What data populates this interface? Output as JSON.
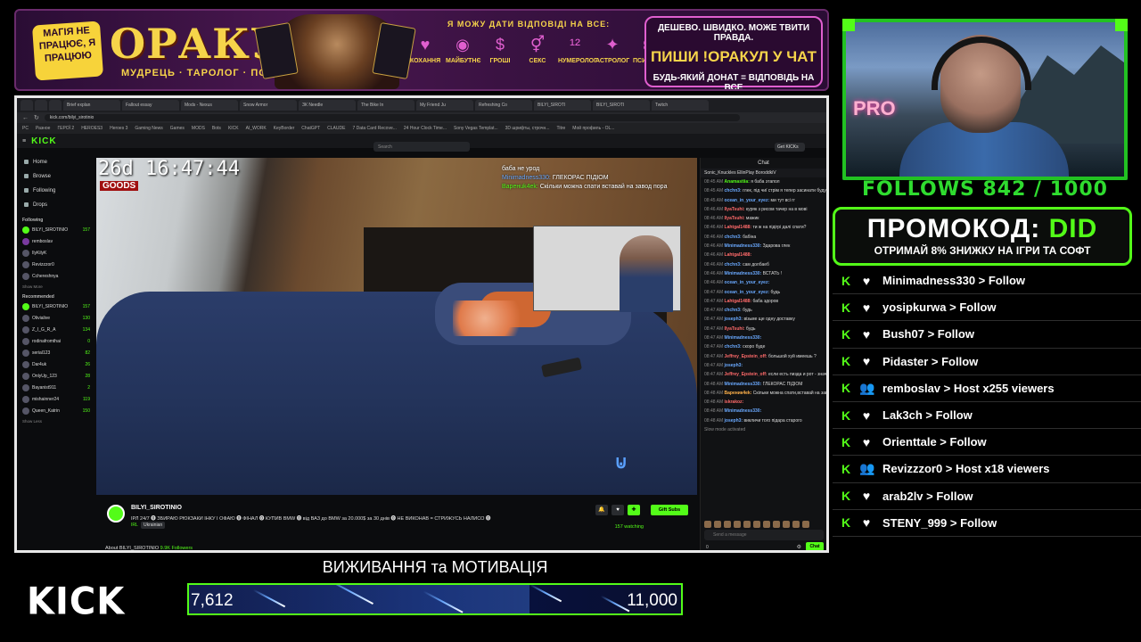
{
  "banner": {
    "badge_text": "МАГІЯ НЕ ПРАЦЮЄ, Я ПРАЦЮЮ",
    "title": "ОРАКУЛ",
    "subtitle": "МУДРЕЦЬ · ТАРОЛОГ · ПСИХОЛОГ",
    "answers_heading": "Я МОЖУ ДАТИ ВІДПОВІДІ НА ВСЕ:",
    "topics": [
      "КОХАННЯ",
      "МАЙБУТНЄ",
      "ГРОШІ",
      "СЕКС",
      "НУМЕРОЛОГ",
      "АСТРОЛОГ",
      "ПСИХОЛОГ"
    ],
    "cta_line1": "ДЕШЕВО. ШВИДКО. МОЖЕ ТВИТИ ПРАВДА.",
    "cta_line2": "ПИШИ !ОРАКУЛ У ЧАТ",
    "cta_line3": "БУДЬ-ЯКИЙ ДОНАТ = ВІДПОВІДЬ НА ВСЕ"
  },
  "browser": {
    "tabs": [
      "Brief explan",
      "Fallout essay",
      "Mods - Nexus",
      "Snow Armor",
      "ЗК Needle",
      "The Bike In",
      "My Friend Ju",
      "Refreshing Co",
      "BILYI_SIROTI",
      "BILYI_SIROTI",
      "Twitch"
    ],
    "url": "kick.com/bilyi_sirotinio",
    "bookmarks": [
      "PC",
      "Разное",
      "ГЕРОЇ 2",
      "HEROES3",
      "Heroes 3",
      "Gaming News",
      "Games",
      "MODS",
      "Bots",
      "KICK",
      "AI_WORK",
      "KeyBorder",
      "ChatGPT",
      "CLAUDE",
      "7 Data Card Recove...",
      "24 Hour Clock Time...",
      "Sony Vegas Templat...",
      "3D шрифты, строчн...",
      "Titre",
      "Мой профиль - OL..."
    ]
  },
  "kick_page": {
    "search_placeholder": "Search",
    "get_kick": "Get KICKs",
    "nav": [
      "Home",
      "Browse",
      "Following",
      "Drops"
    ],
    "following_header": "Following",
    "following": [
      {
        "name": "BILYI_SIROTINIO",
        "viewers": "157"
      },
      {
        "name": "remboslav",
        "viewers": ""
      },
      {
        "name": "IlyKilyK",
        "viewers": ""
      },
      {
        "name": "Revizzzor0",
        "viewers": ""
      },
      {
        "name": "Cchereshnya",
        "viewers": ""
      }
    ],
    "show_more": "Show More",
    "recommended_header": "Recommended",
    "recommended": [
      {
        "name": "BILYI_SIROTINIO",
        "viewers": "157"
      },
      {
        "name": "Olivialive",
        "viewers": "130"
      },
      {
        "name": "Z_I_G_R_A",
        "viewers": "134"
      },
      {
        "name": "rodinafromthai",
        "viewers": "0"
      },
      {
        "name": "serial123",
        "viewers": "82"
      },
      {
        "name": "Dar4uk",
        "viewers": "26"
      },
      {
        "name": "OnlyUp_123",
        "viewers": "28"
      },
      {
        "name": "Bayanist911",
        "viewers": "2"
      },
      {
        "name": "mishainner24",
        "viewers": "119"
      },
      {
        "name": "Queen_Katrin",
        "viewers": "150"
      }
    ],
    "show_less": "Show Less",
    "video_timestamp": "26d 16:47:44",
    "video_tag": "GOODS",
    "overlay_chat": [
      {
        "user": "",
        "text": "баба не урод"
      },
      {
        "user": "Minimadness330:",
        "text": "ГЛЕКОРАС ПІДІОМ"
      },
      {
        "user": "Варенuk4ek:",
        "text": "Скільки можна спати вставай на завод пора"
      }
    ],
    "channel_name": "BILYI_SIROTINIO",
    "stream_title": "ІРЛ 24/7 ⓿ ЗБИРАЮ РЮКЗАКИ ІНКУ І ОФАЮ ⓿ ФІНАЛ ⓿ КУПИВ BMW ⓿ від ВАЗ до BMW за 20.000$ за 30 днів ⓿ НЕ ВИКОНАВ = СТРИЖУСЬ НАЛИСО ⓿",
    "category": "IRL",
    "language": "Ukrainian",
    "gift_subs": "Gift Subs",
    "watching": "157 watching",
    "about": "About BILYI_SIROTINIO",
    "followers": "9.9K Followers",
    "chat_header": "Chat",
    "pinned": "Sonic_Knuckles  EllinPlay  BoroddkiV",
    "chat_messages": [
      {
        "t": "08:45 AM",
        "u": "Anamastiia:",
        "c": "g",
        "m": "я баба этапол"
      },
      {
        "t": "08:45 AM",
        "u": "chchn3:",
        "c": "",
        "m": "глек, під чиї стрім я тепер засинати буду?"
      },
      {
        "t": "08:45 AM",
        "u": "ocean_in_your_eyez:",
        "c": "",
        "m": "ми тут всі гг"
      },
      {
        "t": "08:46 AM",
        "u": "IlyaTsuhi:",
        "c": "r",
        "m": "куряк з рисом тачер на в мові"
      },
      {
        "t": "08:46 AM",
        "u": "IlyaTsuhi:",
        "c": "r",
        "m": "мажик"
      },
      {
        "t": "08:46 AM",
        "u": "Lahtgal1488:",
        "c": "r",
        "m": "ти ж на підігрі далі спати?"
      },
      {
        "t": "08:46 AM",
        "u": "chchn3:",
        "c": "",
        "m": "бабіна"
      },
      {
        "t": "08:46 AM",
        "u": "Minimadness330:",
        "c": "",
        "m": "Здарова глек"
      },
      {
        "t": "08:46 AM",
        "u": "Lahtgal1488:",
        "c": "r",
        "m": ""
      },
      {
        "t": "08:46 AM",
        "u": "chchn3:",
        "c": "",
        "m": "сам долбаеб"
      },
      {
        "t": "08:46 AM",
        "u": "Minimadness330:",
        "c": "",
        "m": "ВСТАТЬ !"
      },
      {
        "t": "08:46 AM",
        "u": "ocean_in_your_eyez:",
        "c": "",
        "m": ""
      },
      {
        "t": "08:47 AM",
        "u": "ocean_in_your_eyez:",
        "c": "",
        "m": "будь"
      },
      {
        "t": "08:47 AM",
        "u": "Lahtgal1488:",
        "c": "r",
        "m": "баба здоров"
      },
      {
        "t": "08:47 AM",
        "u": "chchn3:",
        "c": "",
        "m": "будь"
      },
      {
        "t": "08:47 AM",
        "u": "joseph3:",
        "c": "",
        "m": "візьме ще одну доставку"
      },
      {
        "t": "08:47 AM",
        "u": "IlyaTsuhi:",
        "c": "r",
        "m": "будь"
      },
      {
        "t": "08:47 AM",
        "u": "Minimadness330:",
        "c": "",
        "m": ""
      },
      {
        "t": "08:47 AM",
        "u": "chchn3:",
        "c": "",
        "m": "скоро буде"
      },
      {
        "t": "08:47 AM",
        "u": "Jeffrey_Epstein_off:",
        "c": "r",
        "m": "большой хуй имеешь ?"
      },
      {
        "t": "08:47 AM",
        "u": "joseph3:",
        "c": "",
        "m": ""
      },
      {
        "t": "08:47 AM",
        "u": "Jeffrey_Epstein_off:",
        "c": "r",
        "m": "если есть пизда и рот - значит баба не урод"
      },
      {
        "t": "08:48 AM",
        "u": "Minimadness330:",
        "c": "",
        "m": "ГЛЕКОРАС ПІДІОМ"
      },
      {
        "t": "08:48 AM",
        "u": "Вареник4ek:",
        "c": "o",
        "m": "Скільки можна спати,вставай на завод пора"
      },
      {
        "t": "08:48 AM",
        "u": "iskrakoz:",
        "c": "r",
        "m": ""
      },
      {
        "t": "08:48 AM",
        "u": "Minimadness330:",
        "c": "",
        "m": ""
      },
      {
        "t": "08:48 AM",
        "u": "joseph3:",
        "c": "",
        "m": "викличи того підара старого"
      }
    ],
    "slow_mode": "Slow mode activated",
    "send_placeholder": "Send a message",
    "chat_count": "0",
    "chat_button": "Chat"
  },
  "goal": {
    "title": "ВИЖИВАННЯ та МОТИВАЦІЯ",
    "current": 7612,
    "current_label": "7,612",
    "max_label": "11,000",
    "progress_fraction": 0.692
  },
  "kick_logo": "KICK",
  "follows": "FOLLOWS 842 / 1000",
  "promo": {
    "prefix": "ПРОМОКОД: ",
    "code": "DID",
    "subtitle": "ОТРИМАЙ 8% ЗНИЖКУ НА ІГРИ ТА СОФТ"
  },
  "events": [
    {
      "icon": "heart-icon",
      "text": "Minimadness330 > Follow"
    },
    {
      "icon": "heart-icon",
      "text": "yosipkurwa > Follow"
    },
    {
      "icon": "heart-icon",
      "text": "Bush07 > Follow"
    },
    {
      "icon": "heart-icon",
      "text": "Pidaster > Follow"
    },
    {
      "icon": "users-icon",
      "text": "remboslav > Host x255 viewers"
    },
    {
      "icon": "heart-icon",
      "text": "Lak3ch > Follow"
    },
    {
      "icon": "heart-icon",
      "text": "Orienttale > Follow"
    },
    {
      "icon": "users-icon",
      "text": "Revizzzor0 > Host x18 viewers"
    },
    {
      "icon": "heart-icon",
      "text": "arab2lv > Follow"
    },
    {
      "icon": "heart-icon",
      "text": "STENY_999 > Follow"
    }
  ],
  "colors": {
    "kick_green": "#53fc18",
    "banner_gold": "#f6d44a",
    "banner_purple": "#4a1750"
  }
}
